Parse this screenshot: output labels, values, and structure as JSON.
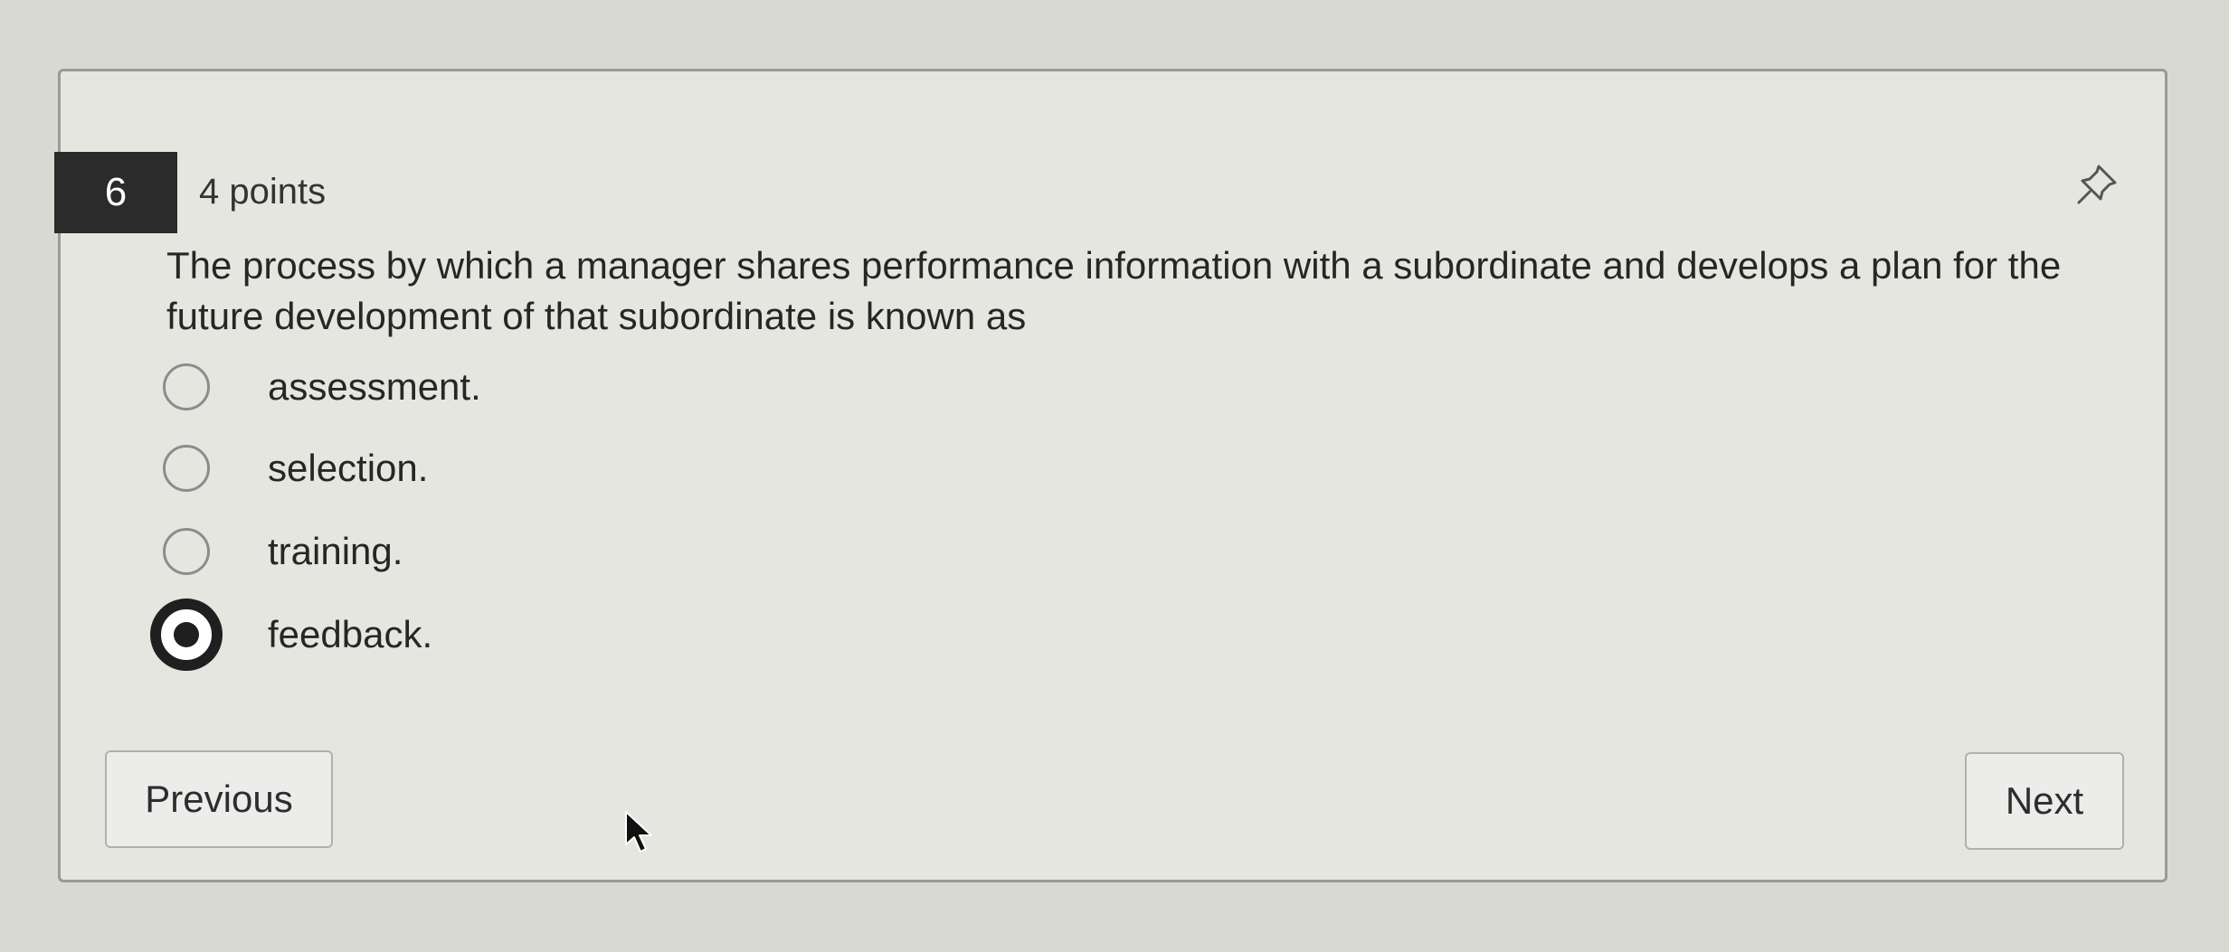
{
  "question": {
    "number": "6",
    "points": "4 points",
    "text": "The process by which a manager shares performance information with a subordinate and develops a plan for the future development of that subordinate is known as",
    "options": [
      {
        "label": "assessment.",
        "selected": false
      },
      {
        "label": "selection.",
        "selected": false
      },
      {
        "label": "training.",
        "selected": false
      },
      {
        "label": "feedback.",
        "selected": true
      }
    ]
  },
  "navigation": {
    "previous_label": "Previous",
    "next_label": "Next"
  },
  "icons": {
    "pin": "pin-icon",
    "cursor": "mouse-cursor-icon"
  },
  "colors": {
    "background": "#d9d9d4",
    "card": "#e6e6e1",
    "number_badge": "#2b2b2b",
    "selected_radio": "#1f1f1f"
  }
}
